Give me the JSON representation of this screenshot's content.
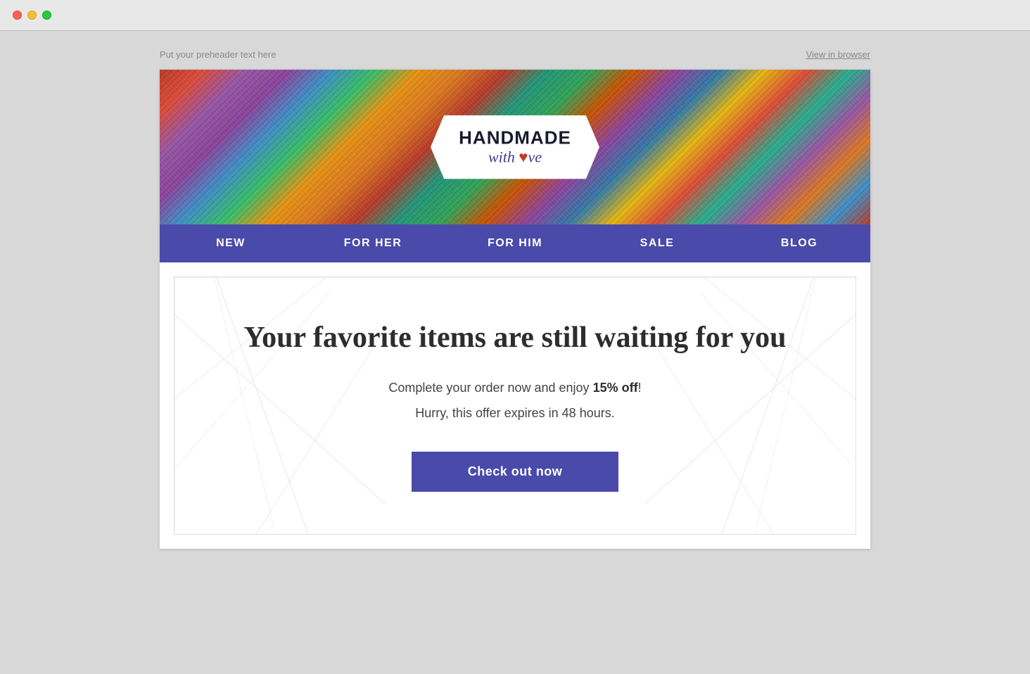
{
  "window": {
    "traffic_lights": {
      "close": "close",
      "minimize": "minimize",
      "maximize": "maximize"
    }
  },
  "email": {
    "preheader": "Put your preheader text here",
    "view_in_browser": "View in browser",
    "logo": {
      "title": "HANDMADE",
      "subtitle_pre": "with ",
      "subtitle_heart": "♥",
      "subtitle_post": "ve",
      "full_subtitle": "with love"
    },
    "nav": {
      "items": [
        {
          "label": "NEW"
        },
        {
          "label": "FOR HER"
        },
        {
          "label": "FOR HIM"
        },
        {
          "label": "SALE"
        },
        {
          "label": "BLOG"
        }
      ]
    },
    "content": {
      "heading": "Your favorite items are still waiting for you",
      "subtext_line1_pre": "Complete your order now and enjoy ",
      "subtext_line1_bold": "15% off",
      "subtext_line1_post": "!",
      "subtext_line2": "Hurry, this offer expires in 48 hours.",
      "cta_label": "Check out now"
    }
  },
  "colors": {
    "nav_bg": "#4a4aaa",
    "cta_bg": "#4a4aaa",
    "logo_text": "#1a1a2e",
    "logo_subtitle": "#3d3d8f",
    "heart": "#c0392b"
  }
}
